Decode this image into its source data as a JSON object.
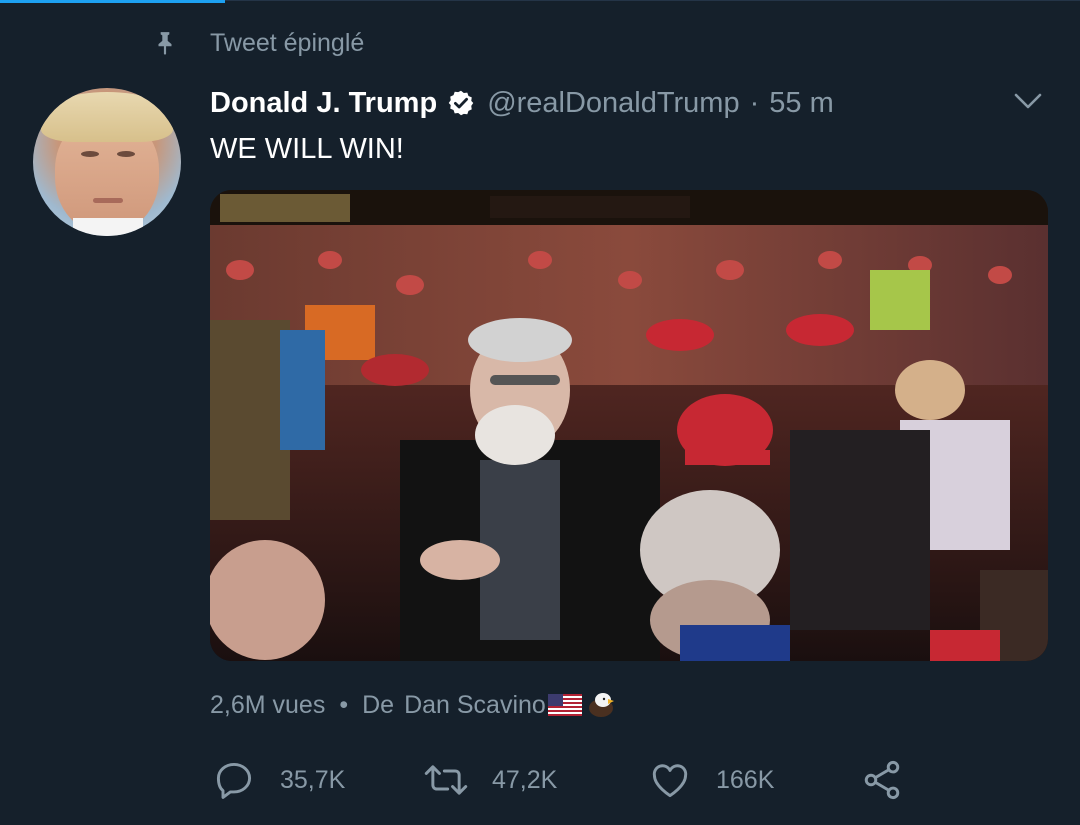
{
  "pinned": {
    "label": "Tweet épinglé"
  },
  "author": {
    "name": "Donald J. Trump",
    "handle": "@realDonaldTrump",
    "separator": "·",
    "time": "55 m"
  },
  "tweet": {
    "text": "WE WILL WIN!"
  },
  "meta": {
    "views": "2,6M vues",
    "dot": "•",
    "from_label": "De",
    "source": "Dan Scavino"
  },
  "actions": {
    "reply_count": "35,7K",
    "retweet_count": "47,2K",
    "like_count": "166K"
  },
  "colors": {
    "background": "#15202b",
    "muted": "#8899a6",
    "accent": "#1da1f2"
  },
  "icons": [
    "pin-icon",
    "verified-icon",
    "chevron-down-icon",
    "flag-icon",
    "eagle-icon",
    "reply-icon",
    "retweet-icon",
    "like-icon",
    "share-icon"
  ]
}
